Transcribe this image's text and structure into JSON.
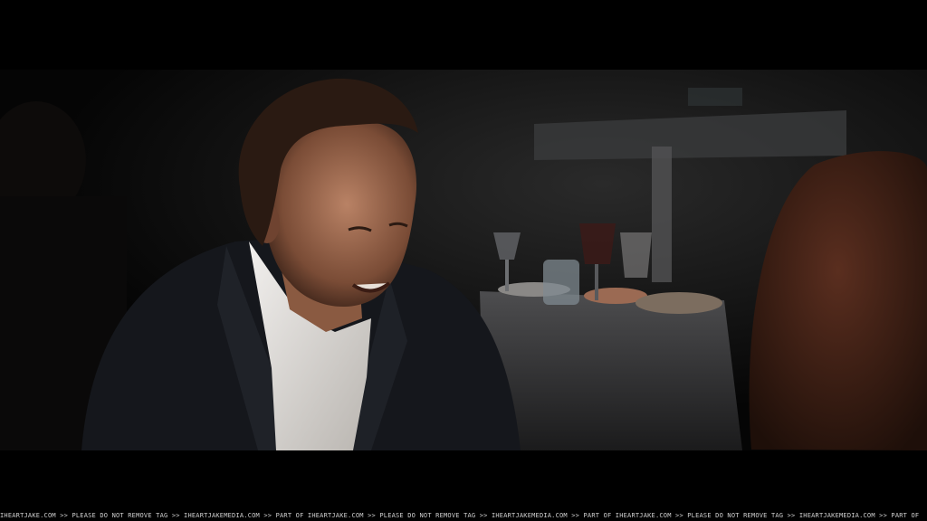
{
  "watermark": {
    "text": "IHEARTJAKE.COM >> PLEASE DO NOT REMOVE TAG >> IHEARTJAKEMEDIA.COM >> PART OF IHEARTJAKE.COM >> PLEASE DO NOT REMOVE TAG >> IHEARTJAKEMEDIA.COM >> PART OF IHEARTJAKE.COM >> PLEASE DO NOT REMOVE TAG >> IHEARTJAKEMEDIA.COM >> PART OF"
  }
}
